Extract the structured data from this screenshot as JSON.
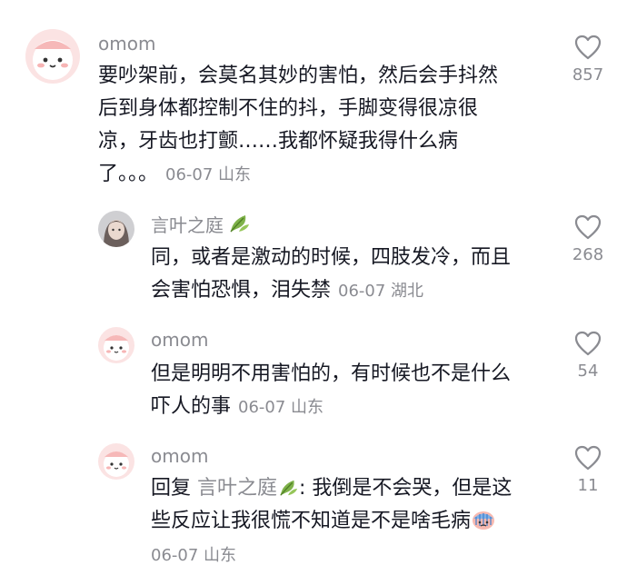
{
  "comments": [
    {
      "username": "omom",
      "line1": "要吵架前，会莫名其妙的害怕，然后会手抖然",
      "line2": "后到身体都控制不住的抖，手脚变得很凉很",
      "line3": "凉，牙齿也打颤……我都怀疑我得什么病",
      "line4": "了。。。",
      "meta": "06-07 山东",
      "likes": "857"
    },
    {
      "username": "言叶之庭",
      "line1": "同，或者是激动的时候，四肢发冷，而且",
      "line2": "会害怕恐惧，泪失禁",
      "meta": "06-07 湖北",
      "likes": "268"
    },
    {
      "username": "omom",
      "line1": "但是明明不用害怕的，有时候也不是什么",
      "line2": "吓人的事",
      "meta": "06-07 山东",
      "likes": "54"
    },
    {
      "username": "omom",
      "reply_prefix": "回复",
      "reply_target": "言叶之庭",
      "line1_rest": ": 我倒是不会哭，但是这",
      "line2": "些反应让我很慌不知道是不是啥毛病",
      "meta": "06-07 山东",
      "likes": "11"
    }
  ]
}
